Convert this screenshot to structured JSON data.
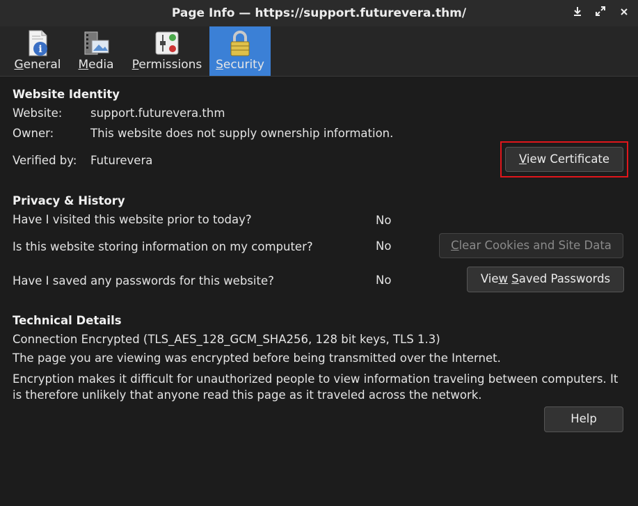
{
  "window": {
    "title": "Page Info — https://support.futurevera.thm/",
    "controls": [
      "download-icon",
      "maximize-icon",
      "close-icon"
    ]
  },
  "tabs": [
    {
      "label_pre": "",
      "label_ul": "G",
      "label_post": "eneral",
      "icon": "document-info-icon"
    },
    {
      "label_pre": "",
      "label_ul": "M",
      "label_post": "edia",
      "icon": "media-icon"
    },
    {
      "label_pre": "",
      "label_ul": "P",
      "label_post": "ermissions",
      "icon": "permissions-icon"
    },
    {
      "label_pre": "",
      "label_ul": "S",
      "label_post": "ecurity",
      "icon": "padlock-icon",
      "active": true
    }
  ],
  "identity": {
    "heading": "Website Identity",
    "website_label": "Website:",
    "website_value": "support.futurevera.thm",
    "owner_label": "Owner:",
    "owner_value": "This website does not supply ownership information.",
    "verified_label": "Verified by:",
    "verified_value": "Futurevera",
    "view_cert_ul": "V",
    "view_cert_rest": "iew Certificate"
  },
  "privacy": {
    "heading": "Privacy & History",
    "q1": "Have I visited this website prior to today?",
    "a1": "No",
    "q2": "Is this website storing information on my computer?",
    "a2": "No",
    "clear_ul": "C",
    "clear_rest": "lear Cookies and Site Data",
    "q3": "Have I saved any passwords for this website?",
    "a3": "No",
    "passwords_pre": "Vie",
    "passwords_ul": "w",
    "passwords_mid": " ",
    "passwords_ul2": "S",
    "passwords_rest": "aved Passwords"
  },
  "technical": {
    "heading": "Technical Details",
    "line1": "Connection Encrypted (TLS_AES_128_GCM_SHA256, 128 bit keys, TLS 1.3)",
    "line2": "The page you are viewing was encrypted before being transmitted over the Internet.",
    "line3": "Encryption makes it difficult for unauthorized people to view information traveling between computers. It is therefore unlikely that anyone read this page as it traveled across the network."
  },
  "help_label": "Help",
  "colors": {
    "accent": "#3b80d6",
    "highlight": "#e0161b"
  }
}
